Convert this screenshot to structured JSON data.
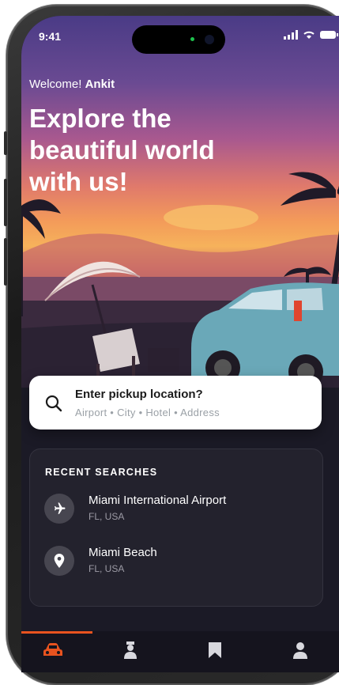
{
  "status_bar": {
    "time": "9:41"
  },
  "header": {
    "welcome_prefix": "Welcome!",
    "user_name": "Ankit"
  },
  "hero": {
    "headline": "Explore the beautiful world with us!"
  },
  "search": {
    "title": "Enter pickup location?",
    "subtitle": "Airport • City • Hotel • Address"
  },
  "recent": {
    "heading": "RECENT SEARCHES",
    "items": [
      {
        "name": "Miami International Airport",
        "location": "FL, USA",
        "icon": "airplane-icon"
      },
      {
        "name": "Miami Beach",
        "location": "FL, USA",
        "icon": "location-pin-icon"
      }
    ]
  },
  "tabbar": {
    "tabs": [
      {
        "icon": "car-icon",
        "active": true
      },
      {
        "icon": "driver-icon",
        "active": false
      },
      {
        "icon": "bookmark-icon",
        "active": false
      },
      {
        "icon": "profile-icon",
        "active": false
      }
    ],
    "active_color": "#e8531f"
  },
  "colors": {
    "accent": "#e8531f",
    "card_bg": "#23222d",
    "screen_bg": "#1b1a26"
  }
}
